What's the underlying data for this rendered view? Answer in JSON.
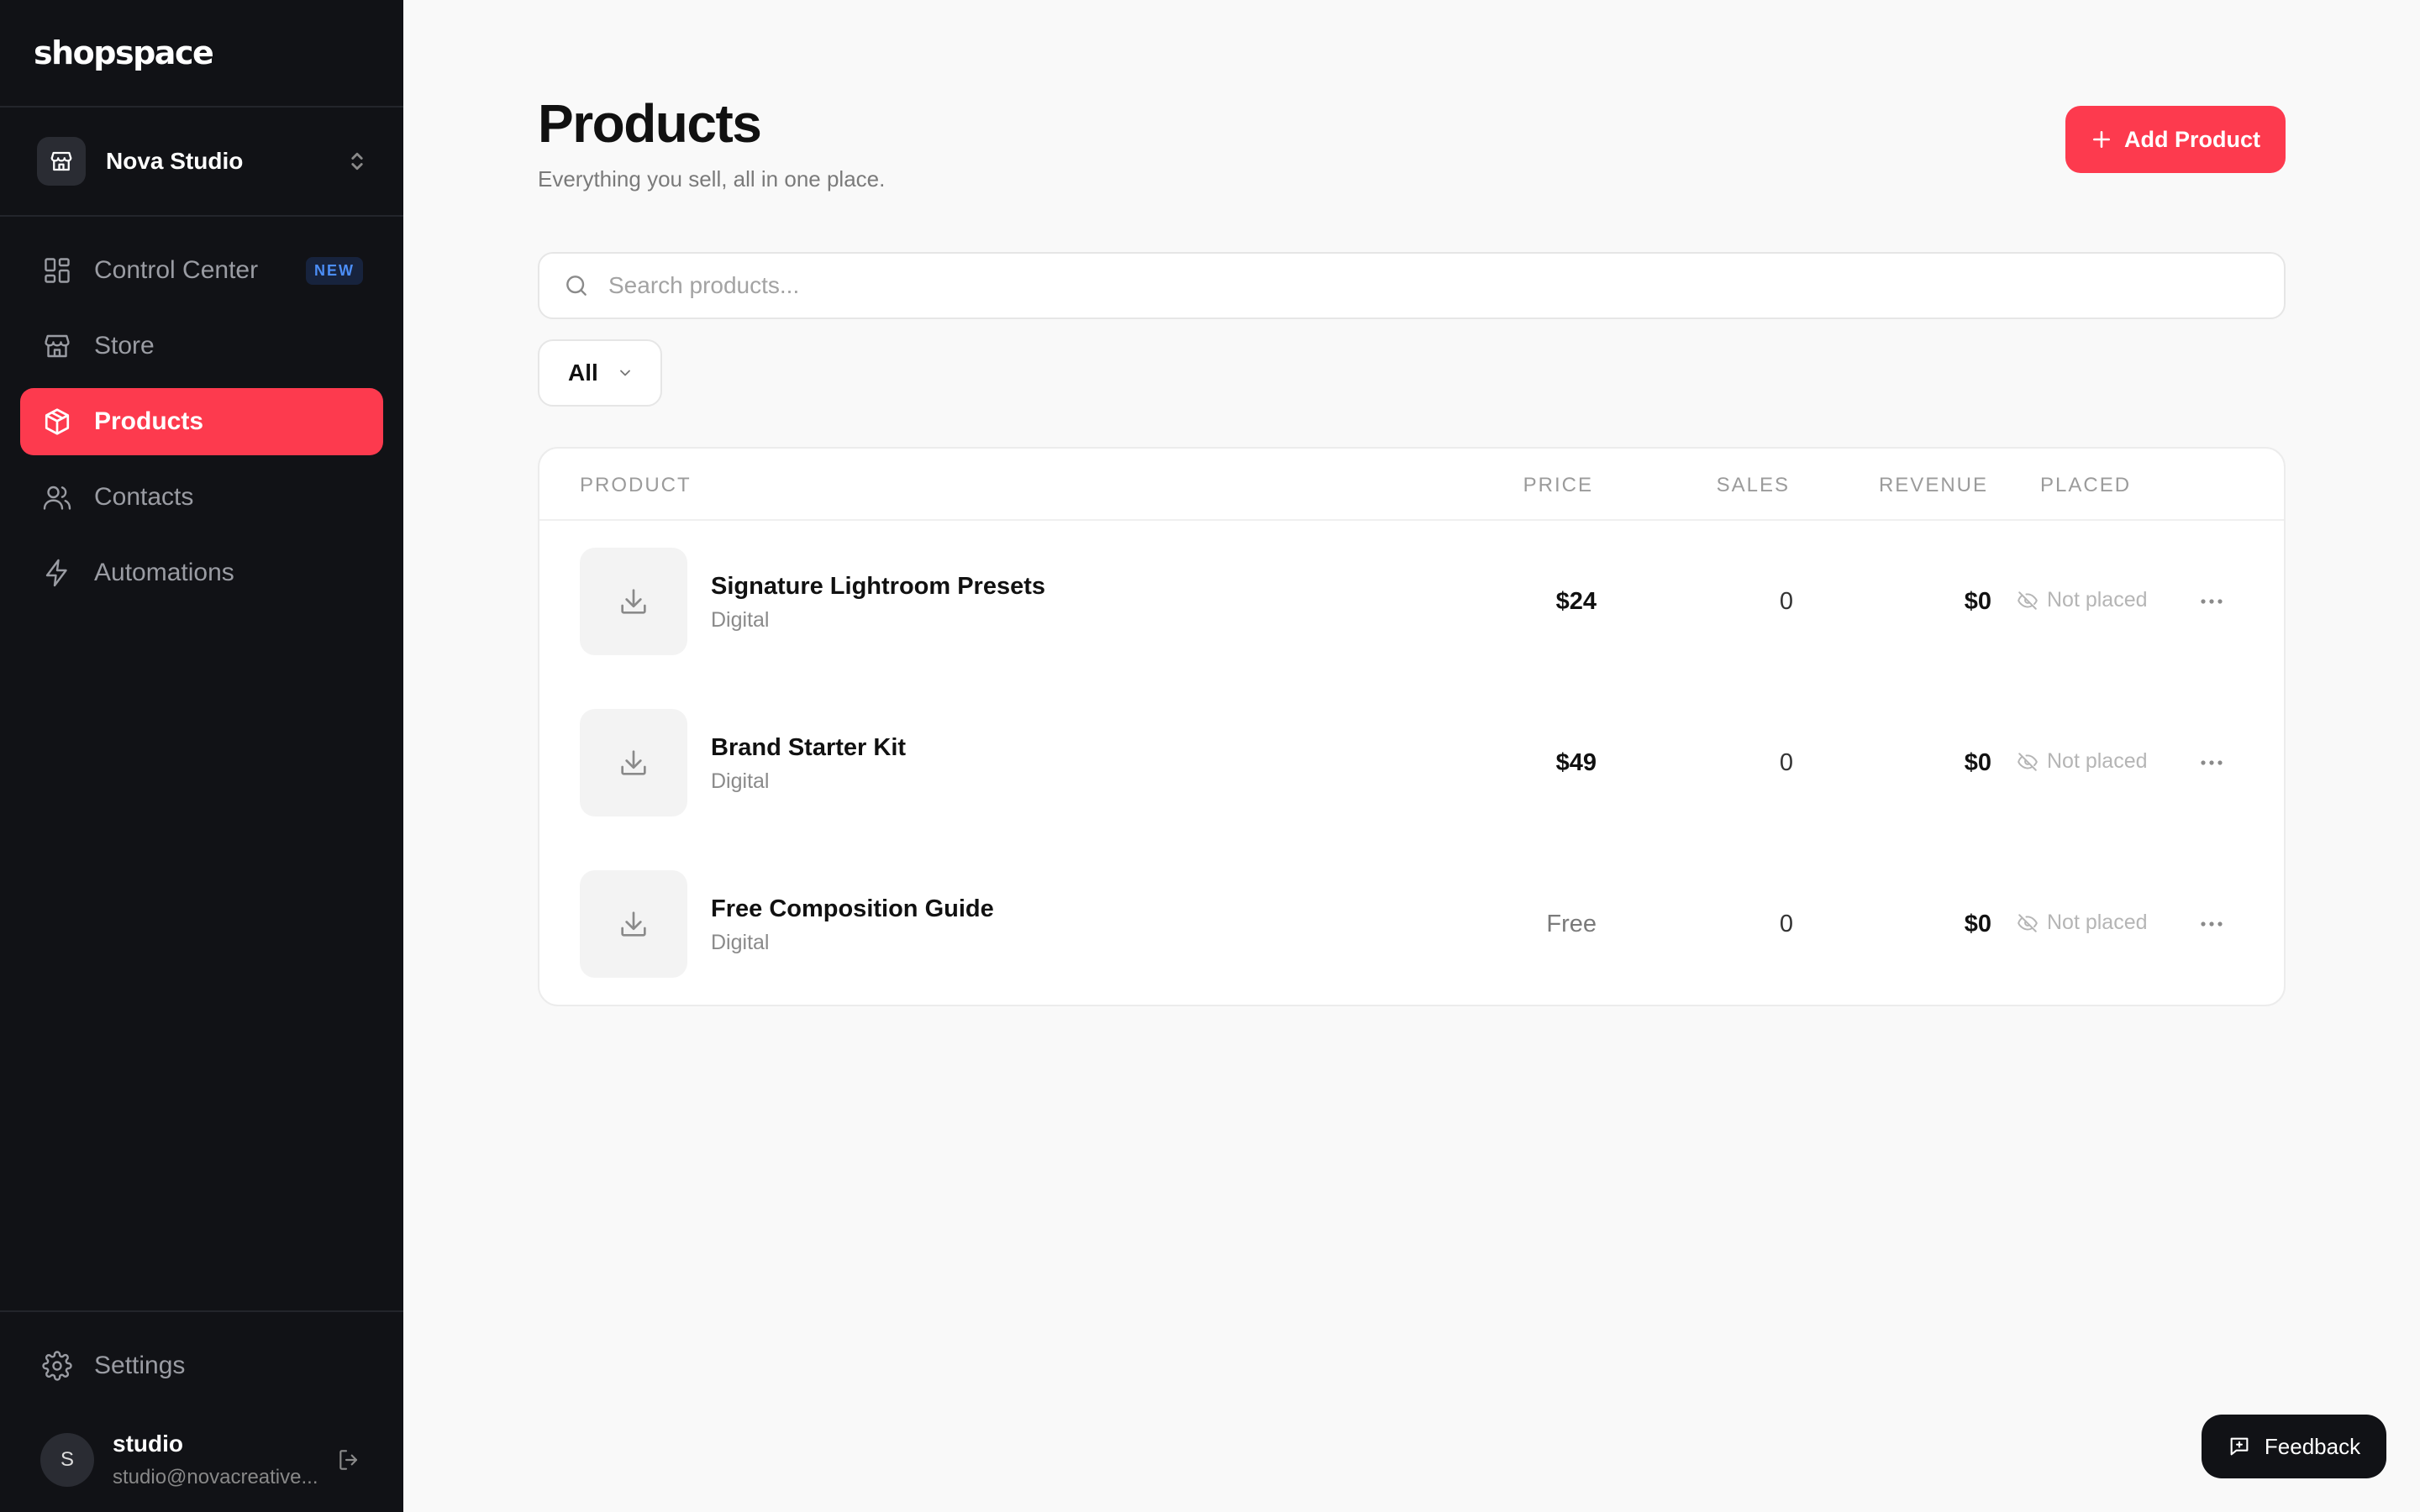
{
  "app": {
    "logo": "shopspace"
  },
  "store": {
    "name": "Nova Studio"
  },
  "sidebar": {
    "items": [
      {
        "label": "Control Center",
        "badge": "NEW",
        "icon": "grid-icon"
      },
      {
        "label": "Store",
        "icon": "storefront-icon"
      },
      {
        "label": "Products",
        "icon": "box-icon",
        "active": true
      },
      {
        "label": "Contacts",
        "icon": "users-icon"
      },
      {
        "label": "Automations",
        "icon": "bolt-icon"
      }
    ],
    "settings_label": "Settings",
    "user": {
      "initial": "S",
      "name": "studio",
      "email": "studio@novacreative..."
    }
  },
  "header": {
    "title": "Products",
    "subtitle": "Everything you sell, all in one place.",
    "add_button": "Add Product"
  },
  "search": {
    "placeholder": "Search products...",
    "value": ""
  },
  "filter": {
    "selected": "All"
  },
  "table": {
    "columns": [
      "PRODUCT",
      "PRICE",
      "SALES",
      "REVENUE",
      "PLACED"
    ],
    "rows": [
      {
        "name": "Signature Lightroom Presets",
        "type": "Digital",
        "price": "$24",
        "sales": "0",
        "revenue": "$0",
        "placed": "Not placed"
      },
      {
        "name": "Brand Starter Kit",
        "type": "Digital",
        "price": "$49",
        "sales": "0",
        "revenue": "$0",
        "placed": "Not placed"
      },
      {
        "name": "Free Composition Guide",
        "type": "Digital",
        "price": "Free",
        "sales": "0",
        "revenue": "$0",
        "placed": "Not placed"
      }
    ]
  },
  "feedback": {
    "label": "Feedback"
  },
  "colors": {
    "accent": "#fd3a4e",
    "sidebar_bg": "#111216",
    "badge_text": "#4c8ef7"
  }
}
